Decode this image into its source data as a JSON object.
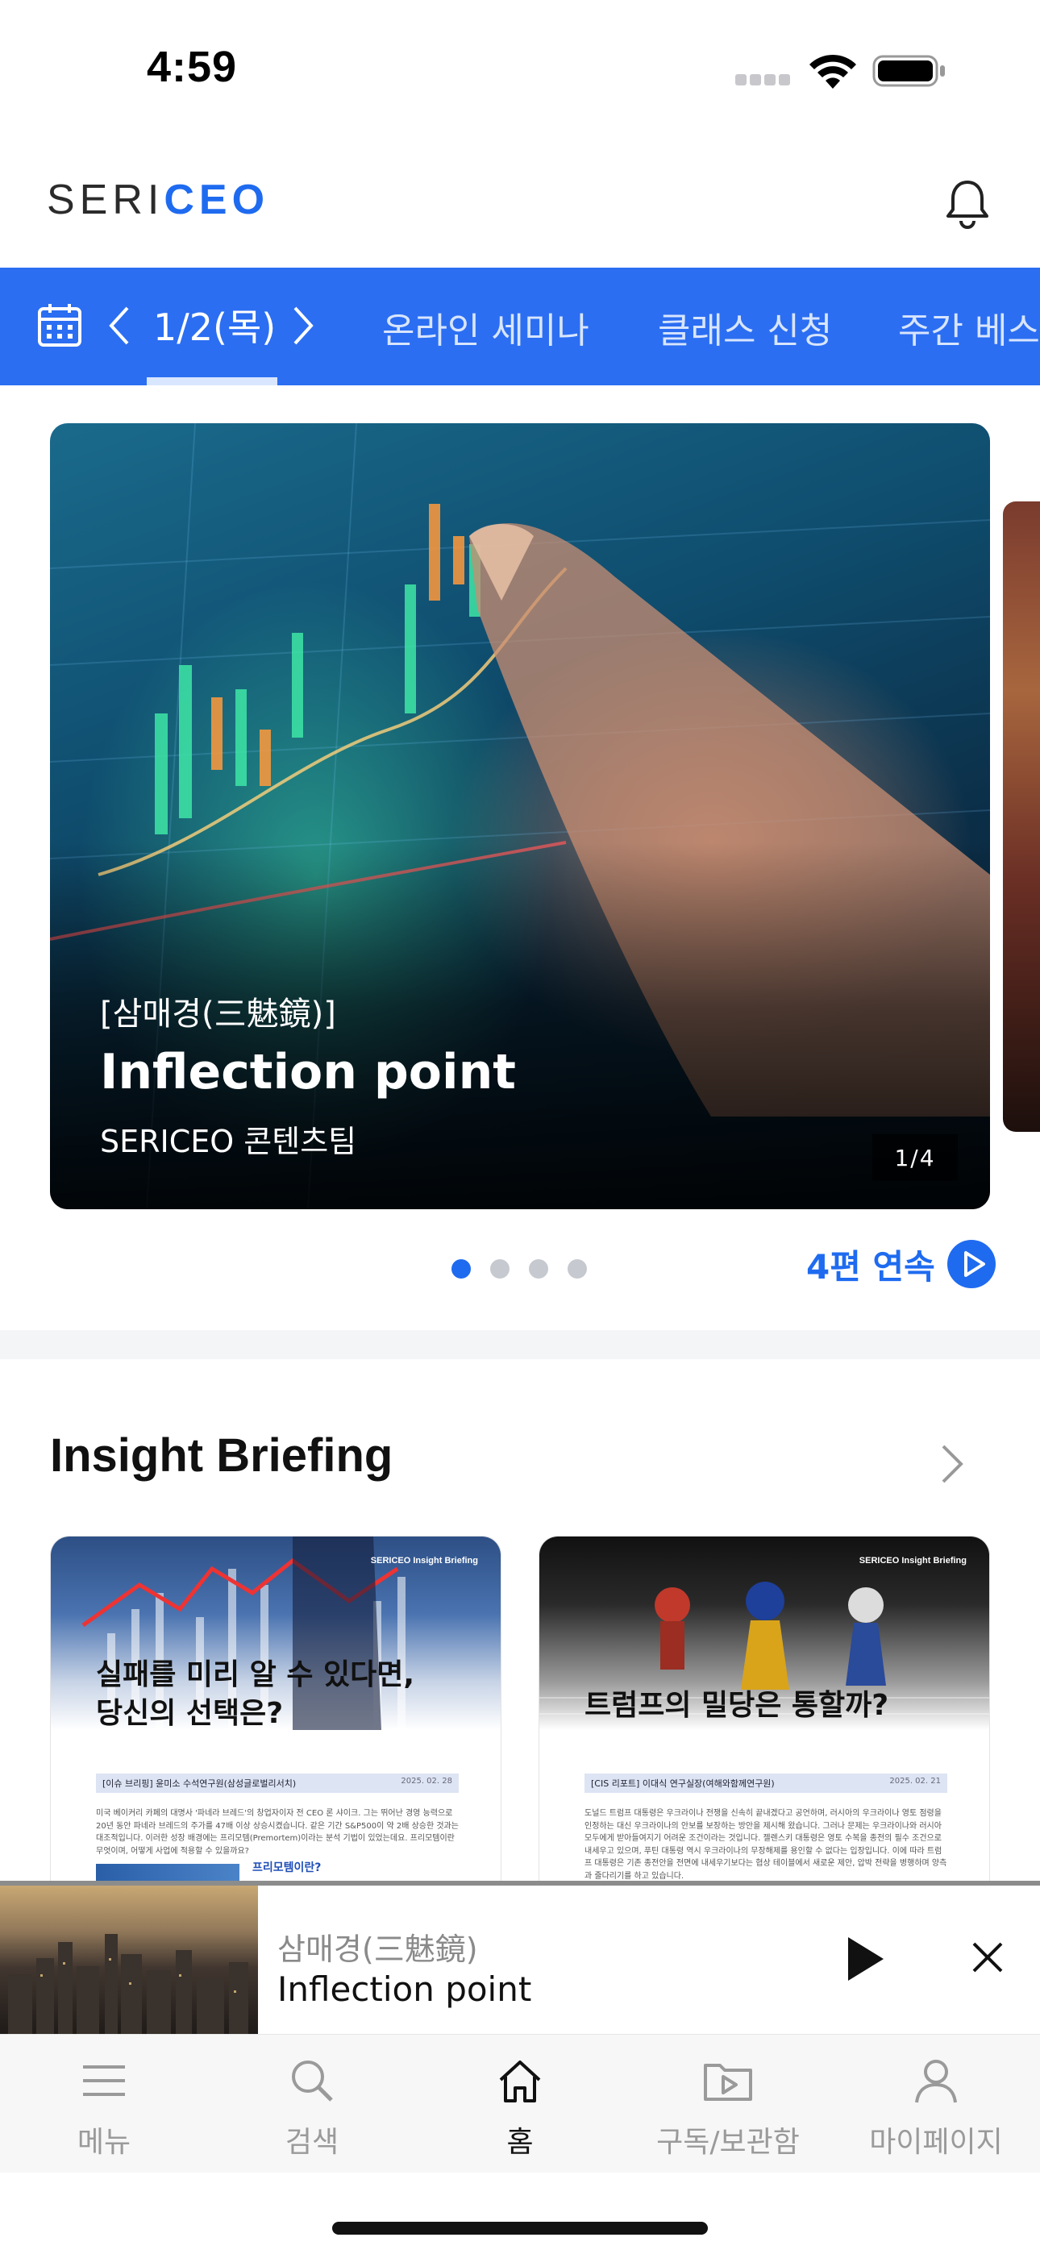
{
  "status_bar": {
    "time": "4:59"
  },
  "header": {
    "logo_part1": "SERI",
    "logo_part2": "CEO",
    "bell_icon": "bell-icon"
  },
  "tabs": {
    "date": "1/2(목)",
    "items": [
      "온라인 세미나",
      "클래스 신청",
      "주간 베스트"
    ],
    "accent": "#2b6ef2"
  },
  "hero": {
    "category": "[삼매경(三魅鏡)]",
    "title": "Inflection point",
    "author": "SERICEO 콘텐츠팀",
    "counter": "1/4",
    "current_index": 1,
    "total": 4,
    "continuous_label": "4편 연속"
  },
  "insight": {
    "title": "Insight Briefing",
    "cards": [
      {
        "brand": "SERICEO Insight Briefing",
        "headline_line1": "실패를 미리 알 수 있다면,",
        "headline_line2": "당신의 선택은?",
        "band": "[이슈 브리핑] 윤미소 수석연구원(삼성글로벌리서치)",
        "date": "2025. 02. 28",
        "body": "미국 베이커리 카페의 대명사 '파네라 브레드'의 창업자이자 전 CEO 론 샤이크. 그는 뛰어난 경영 능력으로 20년 동안 파네라 브레드의 주가를 47배 이상 상승시켰습니다. 같은 기간 S&P500이 약 2배 상승한 것과는 대조적입니다. 이러한 성장 배경에는 프리모템(Premortem)이라는 분석 기법이 있었는데요. 프리모템이란 무엇이며, 어떻게 사업에 적용할 수 있을까요?",
        "sub": "프리모템이란?"
      },
      {
        "brand": "SERICEO Insight Briefing",
        "headline_line1": "트럼프의 밀당은 통할까?",
        "headline_line2": "",
        "band": "[CIS 리포트] 이대식 연구실장(여해와함께연구원)",
        "date": "2025. 02. 21",
        "body": "도널드 트럼프 대통령은 우크라이나 전쟁을 신속히 끝내겠다고 공언하며, 러시아의 우크라이나 영토 점령을 인정하는 대신 우크라이나의 안보를 보장하는 방안을 제시해 왔습니다. 그러나 문제는 우크라이나와 러시아 모두에게 받아들여지기 어려운 조건이라는 것입니다. 젤렌스키 대통령은 영토 수복을 종전의 필수 조건으로 내세우고 있으며, 푸틴 대통령 역시 우크라이나의 무장해제를 용인할 수 없다는 입장입니다. 이에 따라 트럼프 대통령은 기존 종전안을 전면에 내세우기보다는 협상 테이블에서 새로운 제안, 압박 전략을 병행하며 양측과 줄다리기를 하고 있습니다."
      }
    ]
  },
  "player": {
    "subtitle": "삼매경(三魅鏡)",
    "title": "Inflection point"
  },
  "bottom_nav": {
    "items": [
      {
        "label": "메뉴",
        "icon": "menu-icon"
      },
      {
        "label": "검색",
        "icon": "search-icon"
      },
      {
        "label": "홈",
        "icon": "home-icon"
      },
      {
        "label": "구독/보관함",
        "icon": "play-folder-icon"
      },
      {
        "label": "마이페이지",
        "icon": "person-icon"
      }
    ],
    "active_index": 2
  }
}
